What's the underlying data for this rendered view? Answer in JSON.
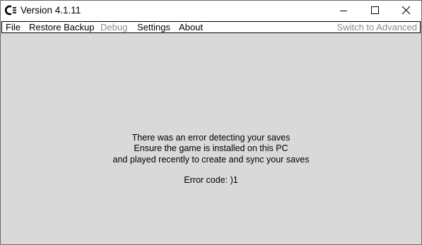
{
  "window": {
    "title": "Version 4.1.11",
    "icons": {
      "app": "app-logo-icon",
      "minimize": "minimize-icon",
      "maximize": "maximize-icon",
      "close": "close-icon"
    }
  },
  "menu": {
    "items": [
      {
        "label": "File",
        "enabled": true
      },
      {
        "label": "Restore Backup",
        "enabled": true
      },
      {
        "label": "Debug",
        "enabled": false
      },
      {
        "label": "Settings",
        "enabled": true
      },
      {
        "label": "About",
        "enabled": true
      }
    ],
    "right_item": {
      "label": "Switch to Advanced",
      "enabled": false
    }
  },
  "content": {
    "lines": [
      "There was an error detecting your saves",
      "Ensure the game is installed on this PC",
      "and played recently to create and sync your saves"
    ],
    "error_code": "Error code: )1"
  },
  "colors": {
    "background": "#d9d9d9",
    "disabled_text": "#8c8c8c"
  }
}
